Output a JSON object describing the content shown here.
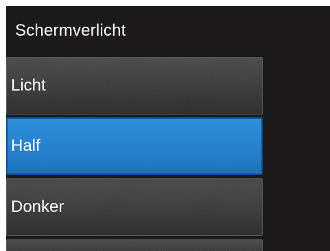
{
  "screen": {
    "title": "Schermverlicht",
    "options": [
      {
        "label": "Licht",
        "selected": false
      },
      {
        "label": "Half",
        "selected": true
      },
      {
        "label": "Donker",
        "selected": false
      }
    ]
  },
  "colors": {
    "background": "#1c1a1a",
    "selected": "#2780cc",
    "button": "#3d3d3d",
    "text": "#ffffff"
  }
}
